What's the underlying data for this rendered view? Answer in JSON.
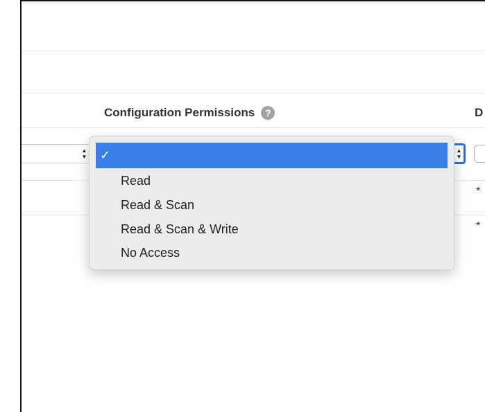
{
  "table": {
    "header_configuration_permissions": "Configuration Permissions",
    "header_help_glyph": "?",
    "header_next_column_fragment": "D",
    "row_asterisk_1": "*",
    "row_asterisk_2": "*"
  },
  "dropdown": {
    "selected_check": "✓",
    "selected_label": "",
    "options": [
      {
        "label": "Read"
      },
      {
        "label": "Read & Scan"
      },
      {
        "label": "Read & Scan & Write"
      },
      {
        "label": "No Access"
      }
    ]
  },
  "colors": {
    "highlight": "#3a7ee9",
    "focus_ring": "#2f70d0",
    "menu_background": "#ececec",
    "help_icon": "#a3a3a3"
  },
  "icons": {
    "help": "question-circle-icon",
    "stepper": "up-down-arrows-icon",
    "check": "checkmark-icon"
  }
}
